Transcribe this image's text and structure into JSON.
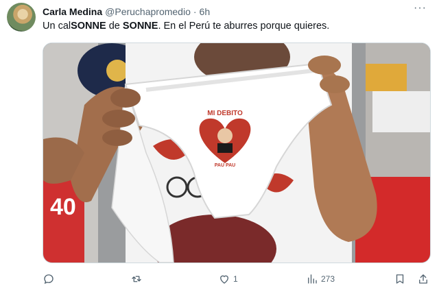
{
  "tweet": {
    "author_name": "Carla Medina",
    "handle": "@Peruchapromedio",
    "separator": "·",
    "time": "6h",
    "more_label": "···",
    "text_part1": "Un cal",
    "text_bold1": "SONNE",
    "text_part2": " de ",
    "text_bold2": "SONNE",
    "text_part3": ". En el Perú te aburres porque quieres."
  },
  "media": {
    "underwear_top_text": "MI DEBITO",
    "underwear_bottom_text": "PAU PAU"
  },
  "actions": {
    "reply_icon": "reply-icon",
    "retweet_icon": "retweet-icon",
    "like_icon": "heart-icon",
    "like_count": "1",
    "views_icon": "views-icon",
    "views_count": "273",
    "bookmark_icon": "bookmark-icon",
    "share_icon": "share-icon"
  }
}
